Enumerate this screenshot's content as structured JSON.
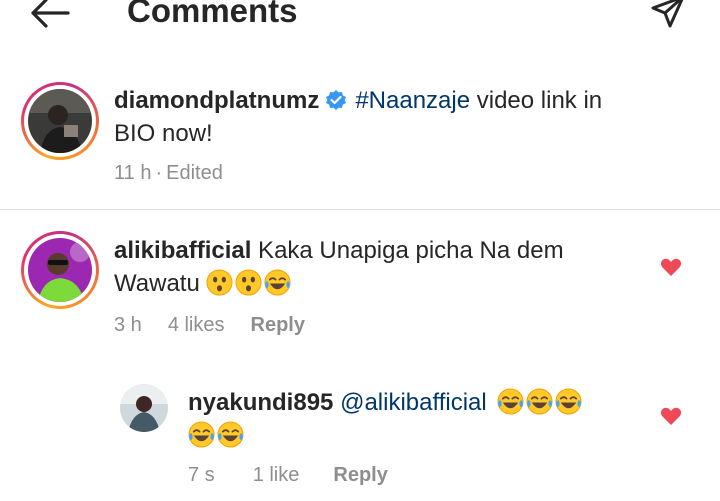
{
  "header": {
    "title": "Comments"
  },
  "caption": {
    "username": "diamondplatnumz",
    "hashtag": "#Naanzaje",
    "text_line1": " video link in",
    "text_line2": "BIO now!",
    "time": "11 h",
    "separator": "·",
    "edited": "Edited"
  },
  "comments": [
    {
      "username": "alikibafficial",
      "text_line1": " Kaka Unapiga picha Na dem",
      "text_line2": "Wawatu ",
      "time": "3 h",
      "likes": "4 likes",
      "reply": "Reply",
      "liked": true
    },
    {
      "username": "nyakundi895",
      "mention": " @alikibafficial",
      "time": "7 s",
      "likes": "1 like",
      "reply": "Reply",
      "liked": true
    }
  ],
  "colors": {
    "heart": "#ed4956",
    "link": "#00376b",
    "verified": "#3897f0",
    "meta": "#8e8e8e"
  },
  "icons": [
    "back-arrow-icon",
    "send-icon",
    "verified-badge-icon",
    "heart-icon",
    "astonished-face-emoji",
    "laughing-tears-emoji"
  ]
}
